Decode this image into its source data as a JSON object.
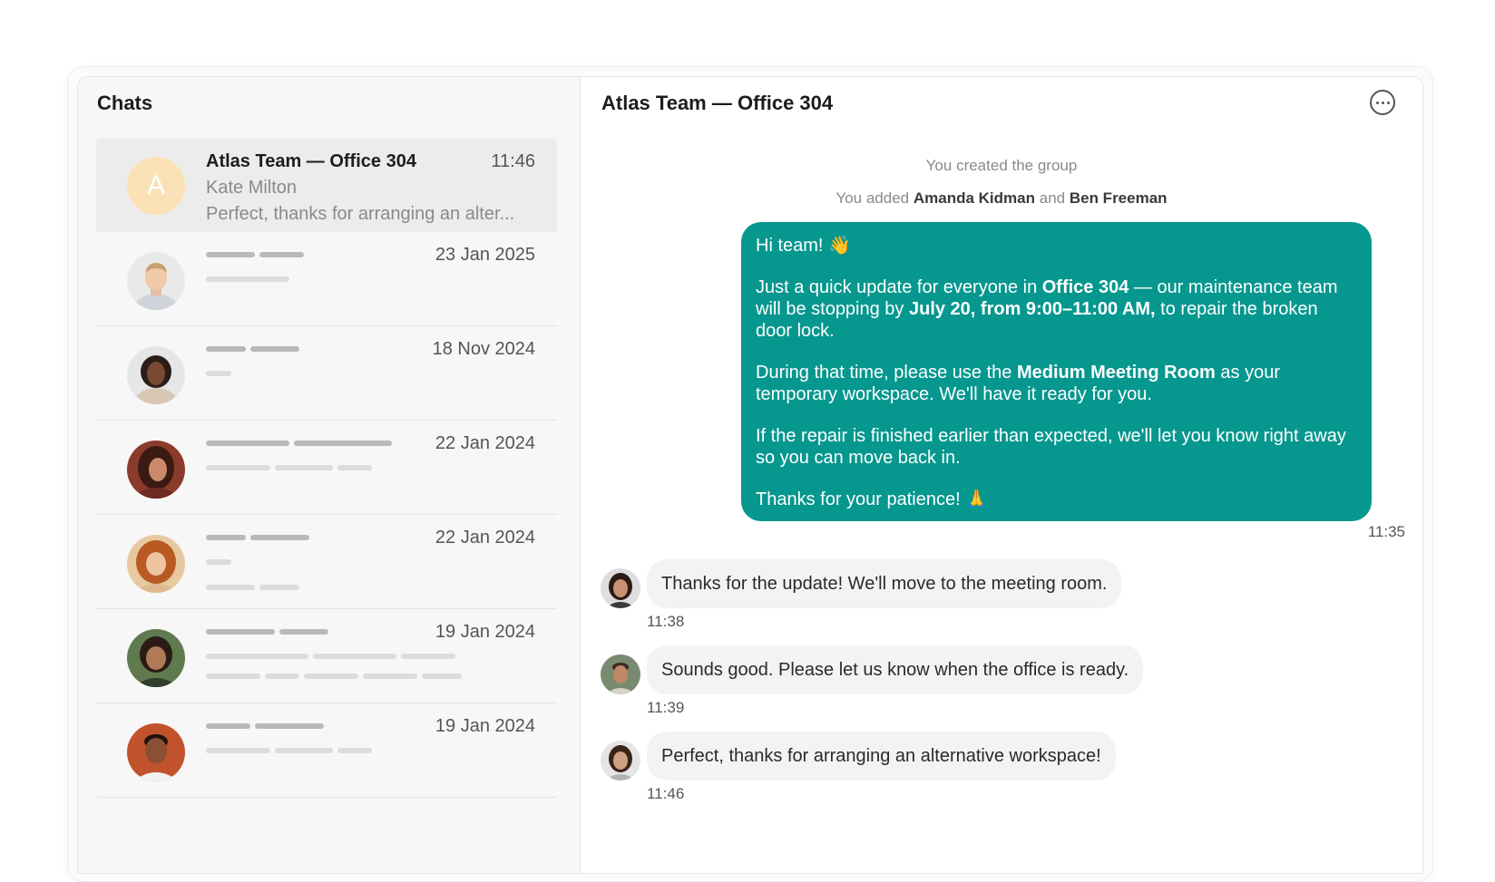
{
  "sidebar": {
    "title": "Chats",
    "active_chat": {
      "avatar_letter": "A",
      "name": "Atlas Team — Office 304",
      "time": "11:46",
      "sender": "Kate Milton",
      "preview": "Perfect, thanks for arranging an alter..."
    },
    "dates": [
      "23 Jan 2025",
      "18 Nov 2024",
      "22 Jan 2024",
      "22 Jan 2024",
      "19 Jan 2024",
      "19 Jan 2024"
    ]
  },
  "conversation": {
    "title": "Atlas Team — Office 304",
    "system": {
      "created": "You created the group",
      "added_prefix": "You added",
      "added_name_1": "Amanda Kidman",
      "added_and": "and",
      "added_name_2": "Ben Freeman"
    },
    "outgoing": {
      "greeting": "Hi team! 👋",
      "p1_a": "Just a quick update for everyone in ",
      "p1_b": "Office 304",
      "p1_c": " — our maintenance team will be stopping by ",
      "p1_d": "July 20, from 9:00–11:00 AM,",
      "p1_e": " to repair the broken door lock.",
      "p2_a": "During that time, please use the ",
      "p2_b": "Medium Meeting Room",
      "p2_c": " as your temporary workspace. We'll have it ready for you.",
      "p3": "If the repair is finished earlier than expected, we'll let you know right away so you can move back in.",
      "p4": "Thanks for your patience! 🙏",
      "time": "11:35"
    },
    "incoming": [
      {
        "text": "Thanks for the update! We'll move to the meeting room.",
        "time": "11:38"
      },
      {
        "text": "Sounds good. Please let us know when the office is ready.",
        "time": "11:39"
      },
      {
        "text": "Perfect, thanks for arranging an alternative workspace!",
        "time": "11:46"
      }
    ]
  },
  "colors": {
    "accent_teal": "#06978e",
    "sidebar_bg": "#f7f7f7",
    "active_avatar": "#fbe2b6"
  }
}
